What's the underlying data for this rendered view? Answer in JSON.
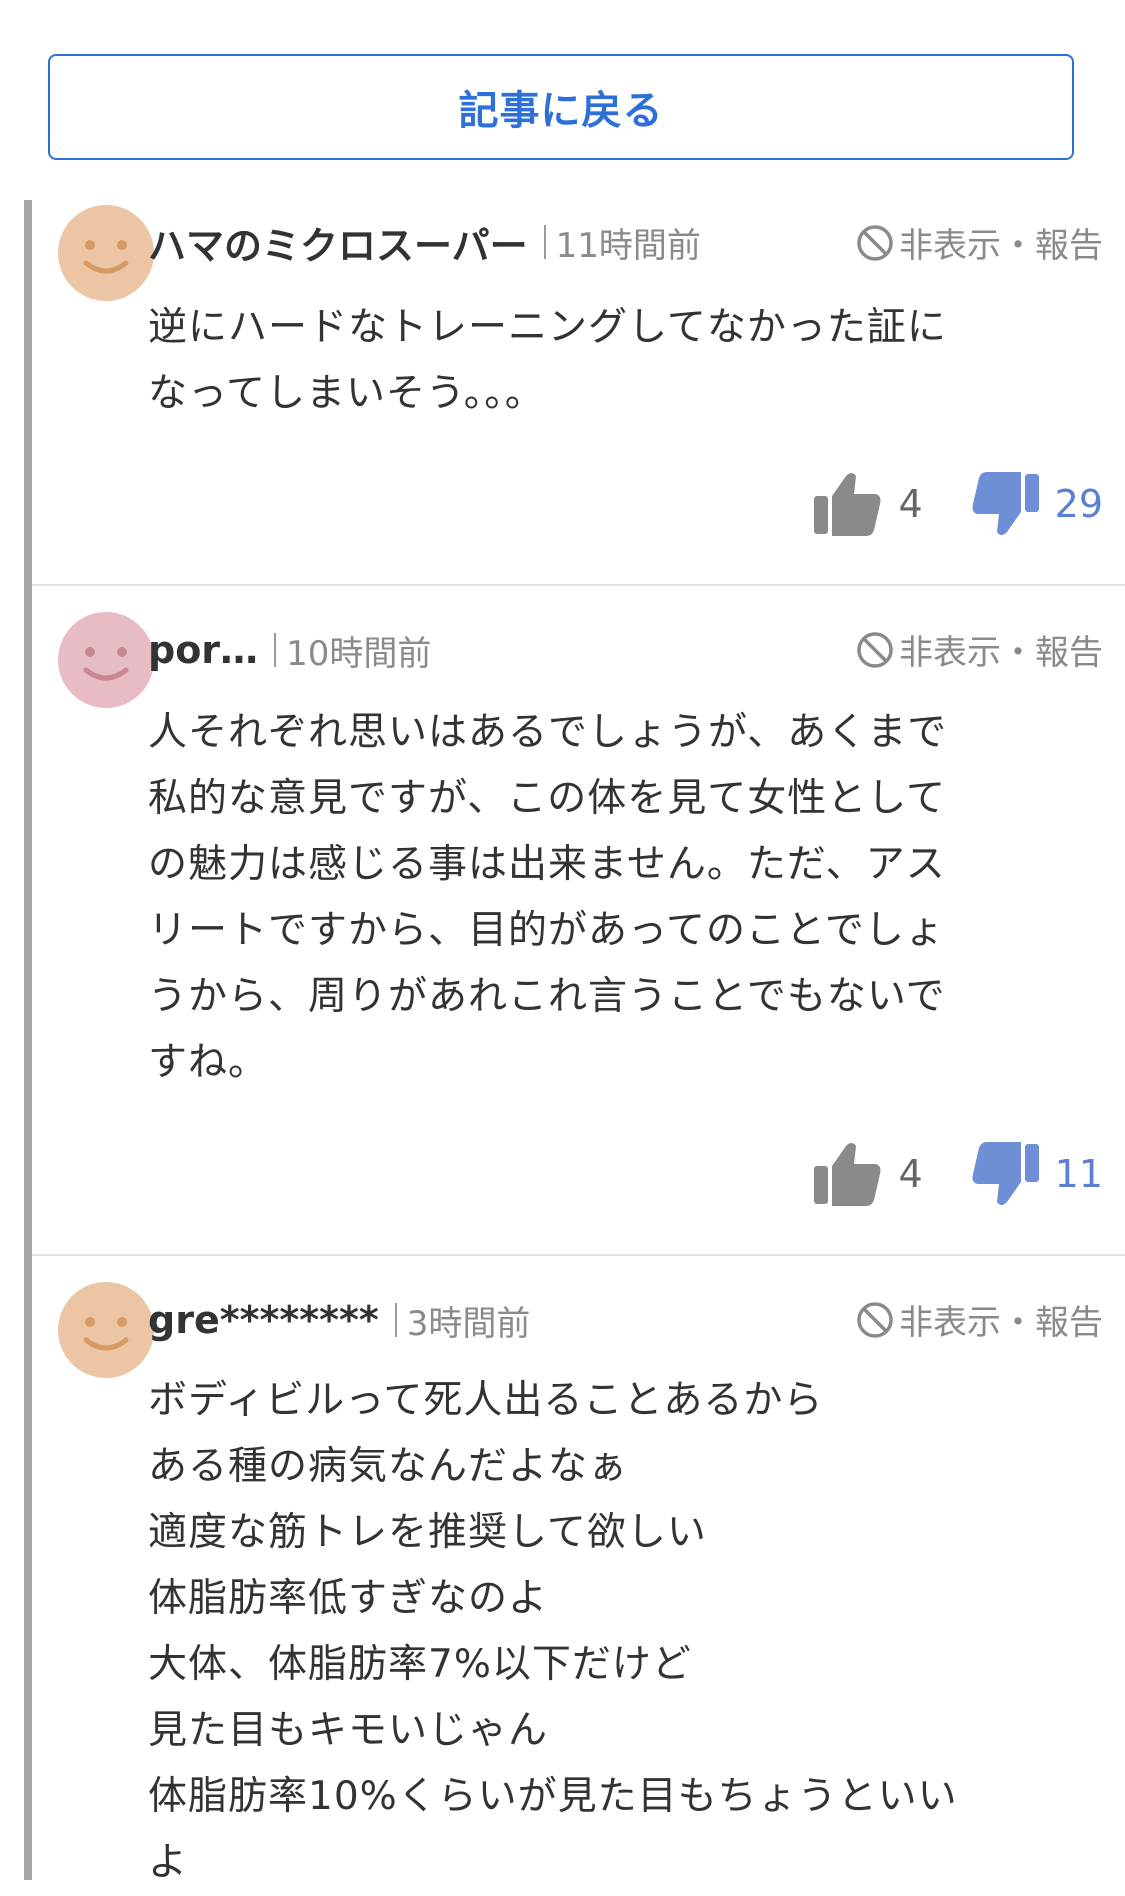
{
  "back_button": {
    "label": "記事に戻る"
  },
  "colors": {
    "accent": "#2f6fd8",
    "dislike": "#6e8ed6",
    "like": "#8a8a8a",
    "thread_bar": "#a7a7a7",
    "avatar_orange": "#ecc6a4",
    "avatar_pink": "#e8bcc4"
  },
  "comments": [
    {
      "username": "ハマのミクロスーパー",
      "time": "11時間前",
      "hide_label": "非表示",
      "dot": "・",
      "report_label": "報告",
      "lines": [
        "逆にハードなトレーニングしてなかった証に",
        "なってしまいそう。。。"
      ],
      "likes": "4",
      "dislikes": "29",
      "avatar_color": "orange"
    },
    {
      "username": "por…",
      "time": "10時間前",
      "hide_label": "非表示",
      "dot": "・",
      "report_label": "報告",
      "lines": [
        "人それぞれ思いはあるでしょうが、あくまで",
        "私的な意見ですが、この体を見て女性として",
        "の魅力は感じる事は出来ません。ただ、アス",
        "リートですから、目的があってのことでしょ",
        "うから、周りがあれこれ言うことでもないで",
        "すね。"
      ],
      "likes": "4",
      "dislikes": "11",
      "avatar_color": "pink"
    },
    {
      "username": "gre********",
      "time": "3時間前",
      "hide_label": "非表示",
      "dot": "・",
      "report_label": "報告",
      "lines": [
        "ボディビルって死人出ることあるから",
        "ある種の病気なんだよなぁ",
        "適度な筋トレを推奨して欲しい",
        "体脂肪率低すぎなのよ",
        "大体、体脂肪率7%以下だけど",
        "見た目もキモいじゃん",
        "体脂肪率10%くらいが見た目もちょうといい",
        "よ"
      ],
      "avatar_color": "orange"
    }
  ]
}
